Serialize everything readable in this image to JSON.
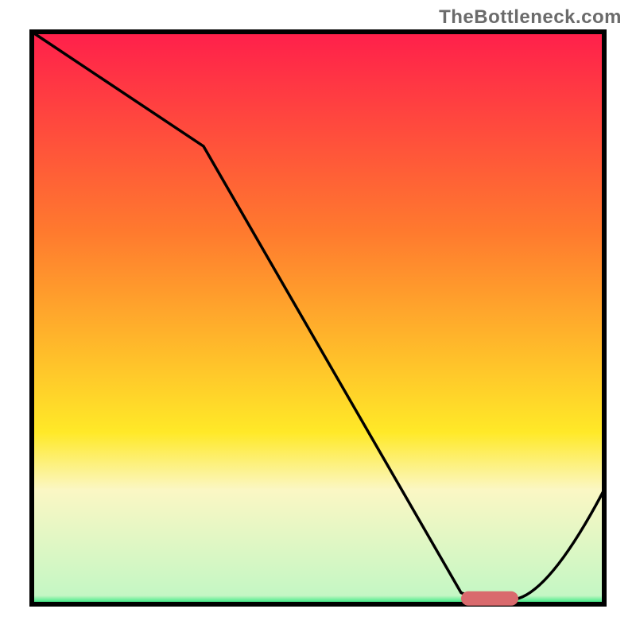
{
  "watermark": "TheBottleneck.com",
  "chart_data": {
    "type": "line",
    "title": "",
    "xlabel": "",
    "ylabel": "",
    "xlim": [
      0,
      100
    ],
    "ylim": [
      0,
      100
    ],
    "x": [
      0,
      30,
      75,
      80,
      85,
      100
    ],
    "values": [
      100,
      80,
      2,
      1,
      1,
      20
    ],
    "optimal_band_x": [
      75,
      85
    ],
    "legend": [],
    "background_gradient": {
      "stops": [
        {
          "pos": 0.0,
          "color": "#ff1f4b"
        },
        {
          "pos": 0.35,
          "color": "#ff7a2e"
        },
        {
          "pos": 0.7,
          "color": "#ffe928"
        },
        {
          "pos": 0.8,
          "color": "#fbf7c4"
        },
        {
          "pos": 0.985,
          "color": "#c4f7c4"
        },
        {
          "pos": 1.0,
          "color": "#17e572"
        }
      ]
    },
    "marker": {
      "kind": "rounded-bar",
      "color": "#d96a6d",
      "y_value": 1
    }
  }
}
